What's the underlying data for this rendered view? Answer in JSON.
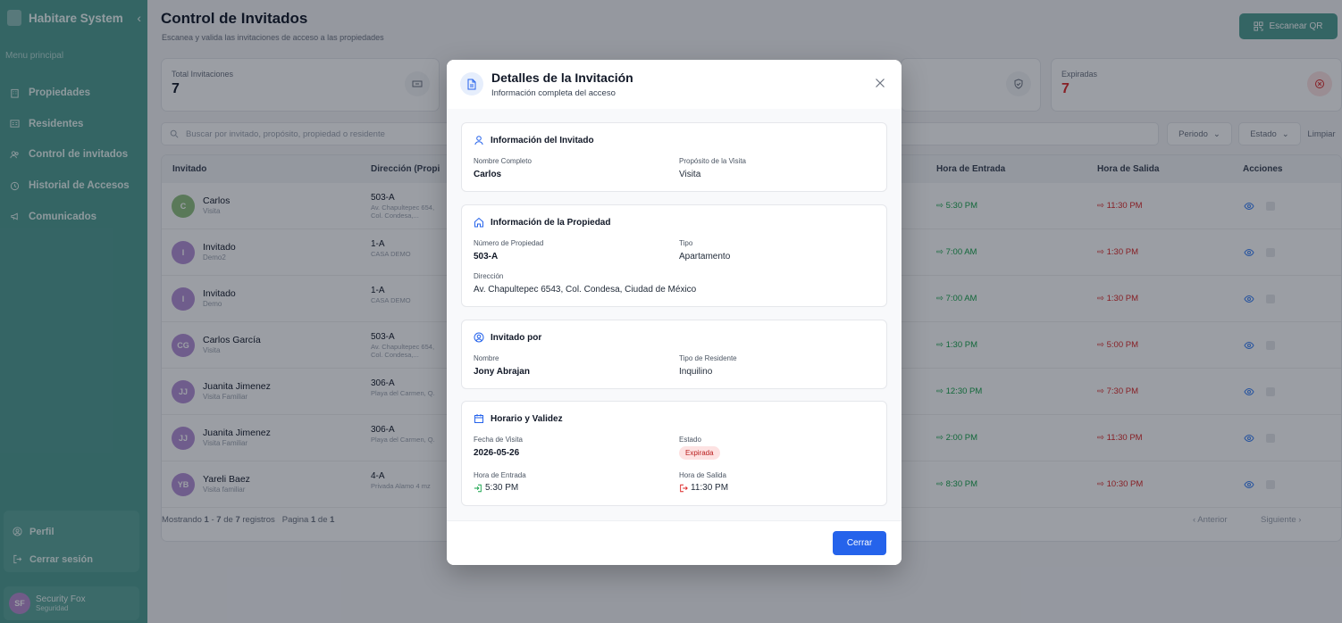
{
  "sidebar": {
    "brand": "Habitare System",
    "collapse_icon": "chevron-left-icon",
    "menu_caption": "Menu principal",
    "items": [
      {
        "label": "Propiedades",
        "icon": "building-icon"
      },
      {
        "label": "Residentes",
        "icon": "id-card-icon"
      },
      {
        "label": "Control de invitados",
        "icon": "users-icon"
      },
      {
        "label": "Historial de Accesos",
        "icon": "clock-icon"
      },
      {
        "label": "Comunicados",
        "icon": "megaphone-icon"
      }
    ],
    "profile_label": "Perfil",
    "logout_label": "Cerrar sesión",
    "user": {
      "initials": "SF",
      "name": "Security Fox",
      "role": "Seguridad"
    }
  },
  "header": {
    "title": "Control de Invitados",
    "subtitle": "Escanea y valida las invitaciones de acceso a las propiedades",
    "scan_button": "Escanear QR"
  },
  "stats": [
    {
      "label": "Total Invitaciones",
      "value": "7"
    },
    {
      "label": "Expiradas",
      "value": "7"
    }
  ],
  "search": {
    "placeholder": "Buscar por invitado, propósito, propiedad o residente"
  },
  "filters": {
    "period": "Periodo",
    "status": "Estado",
    "clear": "Limpiar"
  },
  "table": {
    "columns": {
      "guest": "Invitado",
      "address": "Dirección (Propi",
      "entry": "Hora de Entrada",
      "exit": "Hora de Salida",
      "actions": "Acciones"
    },
    "rows": [
      {
        "initials": "C",
        "color": "#8fbf7f",
        "name": "Carlos",
        "purpose": "Visita",
        "unit": "503-A",
        "address": "Av. Chapultepec 654, Col. Condesa,...",
        "entry": "5:30 PM",
        "exit": "11:30 PM"
      },
      {
        "initials": "I",
        "color": "#b490d6",
        "name": "Invitado",
        "purpose": "Demo2",
        "unit": "1-A",
        "address": "CASA DEMO",
        "entry": "7:00 AM",
        "exit": "1:30 PM"
      },
      {
        "initials": "I",
        "color": "#b490d6",
        "name": "Invitado",
        "purpose": "Demo",
        "unit": "1-A",
        "address": "CASA DEMO",
        "entry": "7:00 AM",
        "exit": "1:30 PM"
      },
      {
        "initials": "CG",
        "color": "#b490d6",
        "name": "Carlos García",
        "purpose": "Visita",
        "unit": "503-A",
        "address": "Av. Chapultepec 654, Col. Condesa,...",
        "entry": "1:30 PM",
        "exit": "5:00 PM"
      },
      {
        "initials": "JJ",
        "color": "#b490d6",
        "name": "Juanita Jimenez",
        "purpose": "Visita Familiar",
        "unit": "306-A",
        "address": "Playa del Carmen, Q.",
        "entry": "12:30 PM",
        "exit": "7:30 PM"
      },
      {
        "initials": "JJ",
        "color": "#b490d6",
        "name": "Juanita Jimenez",
        "purpose": "Visita Familiar",
        "unit": "306-A",
        "address": "Playa del Carmen, Q.",
        "entry": "2:00 PM",
        "exit": "11:30 PM"
      },
      {
        "initials": "YB",
        "color": "#b490d6",
        "name": "Yareli Baez",
        "purpose": "Visita familiar",
        "unit": "4-A",
        "address": "Privada Alamo 4 mz",
        "entry": "8:30 PM",
        "exit": "10:30 PM"
      }
    ],
    "footer": {
      "showing": "Mostrando",
      "from": "1",
      "dash": "-",
      "to": "7",
      "of": "de",
      "total": "7",
      "records": "registros",
      "page_word": "Pagina",
      "page": "1",
      "page_of": "de",
      "pages": "1"
    },
    "prev": "Anterior",
    "next": "Siguiente"
  },
  "modal": {
    "title": "Detalles de la Invitación",
    "subtitle": "Información completa del acceso",
    "guest_section": {
      "heading": "Información del Invitado",
      "name_label": "Nombre Completo",
      "name": "Carlos",
      "purpose_label": "Propósito de la Visita",
      "purpose": "Visita"
    },
    "property_section": {
      "heading": "Información de la Propiedad",
      "number_label": "Número de Propiedad",
      "number": "503-A",
      "type_label": "Tipo",
      "type": "Apartamento",
      "address_label": "Dirección",
      "address": "Av. Chapultepec 6543, Col. Condesa, Ciudad de México"
    },
    "invited_by_section": {
      "heading": "Invitado por",
      "name_label": "Nombre",
      "name": "Jony Abrajan",
      "resident_type_label": "Tipo de Residente",
      "resident_type": "Inquilino"
    },
    "schedule_section": {
      "heading": "Horario y Validez",
      "date_label": "Fecha de Visita",
      "date": "2026-05-26",
      "status_label": "Estado",
      "status": "Expirada",
      "entry_label": "Hora de Entrada",
      "entry": "5:30 PM",
      "exit_label": "Hora de Salida",
      "exit": "11:30 PM"
    },
    "close_button": "Cerrar"
  },
  "colors": {
    "sidebar": "#4f9d92",
    "primary": "#2563eb",
    "entry": "#16a34a",
    "exit": "#dc2626"
  }
}
